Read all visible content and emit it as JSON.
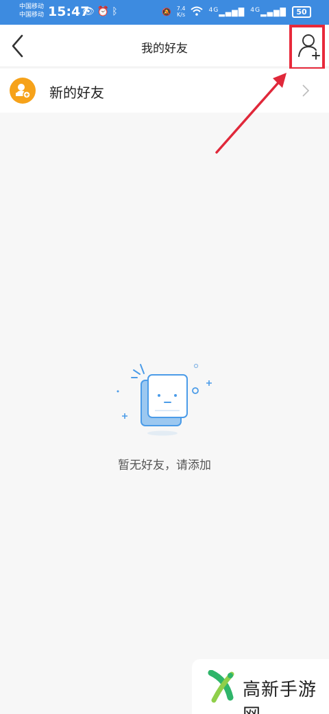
{
  "status_bar": {
    "carrier_1": "中国移动",
    "carrier_2": "中国移动",
    "time": "15:47",
    "speed_value": "7.4",
    "speed_unit": "K/s",
    "network_1": "4G",
    "network_2": "4G",
    "battery": "50"
  },
  "header": {
    "title": "我的好友"
  },
  "new_friends": {
    "label": "新的好友"
  },
  "empty_state": {
    "text": "暂无好友，请添加"
  },
  "watermark": {
    "text": "高新手游网"
  },
  "colors": {
    "status_bar": "#3d8be0",
    "accent_orange": "#f6a21a",
    "highlight_red": "#e8293a",
    "illustration_blue": "#4a9be8"
  }
}
